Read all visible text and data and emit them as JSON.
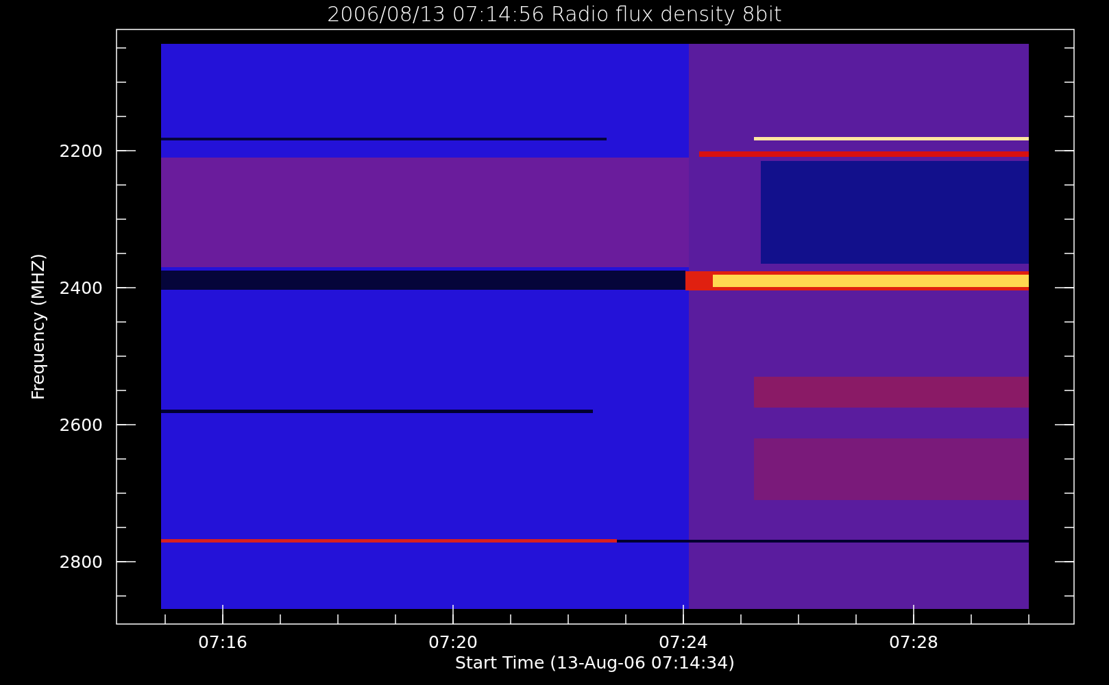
{
  "title": "2006/08/13 07:14:56 Radio flux density 8bit",
  "y_axis": {
    "label": "Frequency (MHZ)",
    "tick_labels": [
      "2200",
      "2400",
      "2600",
      "2800"
    ]
  },
  "x_axis": {
    "label": "Start Time (13-Aug-06 07:14:34)",
    "tick_labels": [
      "07:16",
      "07:20",
      "07:24",
      "07:28"
    ]
  }
}
